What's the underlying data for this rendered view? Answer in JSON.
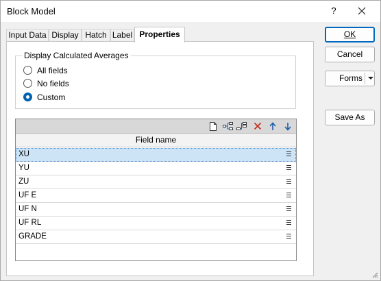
{
  "window": {
    "title": "Block Model",
    "help_label": "?"
  },
  "tabs": [
    {
      "label": "Input Data"
    },
    {
      "label": "Display"
    },
    {
      "label": "Hatch"
    },
    {
      "label": "Label"
    },
    {
      "label": "Properties"
    }
  ],
  "active_tab": "Properties",
  "group": {
    "title": "Display Calculated Averages",
    "options": [
      {
        "label": "All fields",
        "checked": false
      },
      {
        "label": "No fields",
        "checked": false
      },
      {
        "label": "Custom",
        "checked": true
      }
    ]
  },
  "grid": {
    "toolbar_icons": [
      "new-icon",
      "insert-row-icon",
      "add-row-icon",
      "delete-icon",
      "move-up-icon",
      "move-down-icon"
    ],
    "column_header": "Field name",
    "rows": [
      {
        "value": "XU",
        "selected": true
      },
      {
        "value": "YU",
        "selected": false
      },
      {
        "value": "ZU",
        "selected": false
      },
      {
        "value": "UF E",
        "selected": false
      },
      {
        "value": "UF N",
        "selected": false
      },
      {
        "value": "UF RL",
        "selected": false
      },
      {
        "value": "GRADE",
        "selected": false
      }
    ]
  },
  "buttons": {
    "ok": "OK",
    "cancel": "Cancel",
    "forms": "Forms",
    "save_as": "Save As"
  },
  "colors": {
    "accent": "#0063b1",
    "selected_row": "#cde4f7",
    "delete": "#c42b1c",
    "arrows": "#1f5fa8"
  }
}
